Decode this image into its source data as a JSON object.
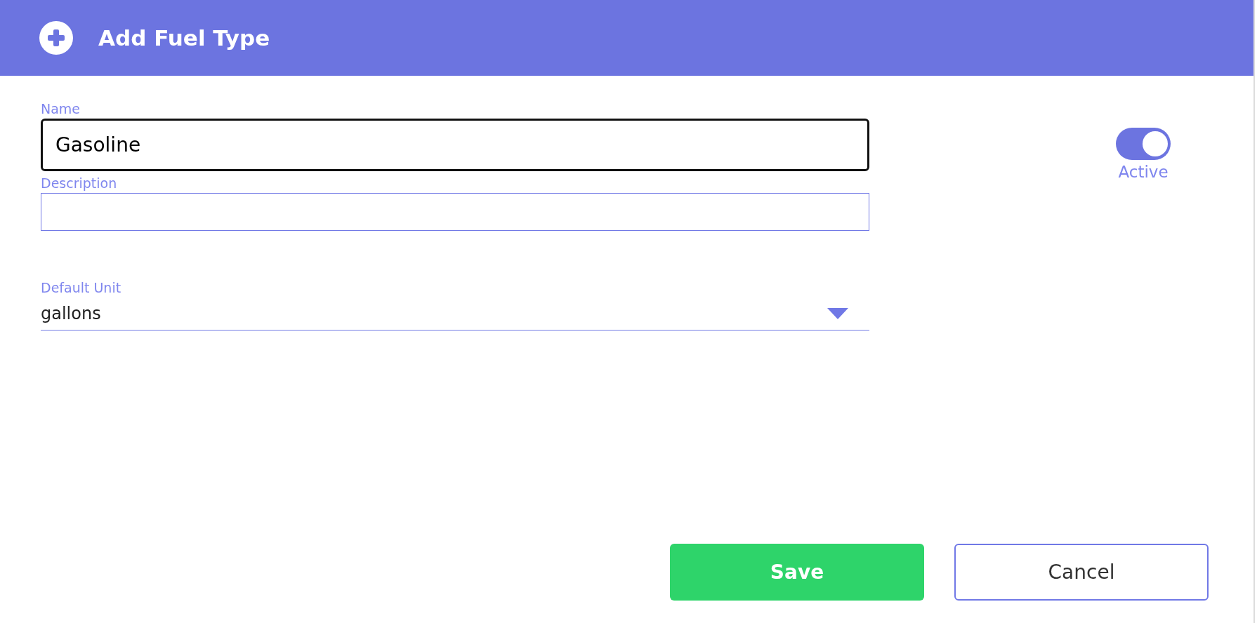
{
  "dialog": {
    "title": "Add Fuel Type"
  },
  "fields": [
    {
      "kind": "text",
      "label": "Name",
      "value": "Gasoline",
      "focused": true
    },
    {
      "kind": "text",
      "label": "Description",
      "focused": false
    },
    {
      "kind": "select",
      "label": "Default Unit",
      "value": "gallons"
    }
  ],
  "active_toggle": {
    "label": "Active",
    "on": true
  },
  "buttons": [
    {
      "kind": "primary",
      "label": "Save"
    },
    {
      "kind": "secondary",
      "label": "Cancel"
    }
  ]
}
